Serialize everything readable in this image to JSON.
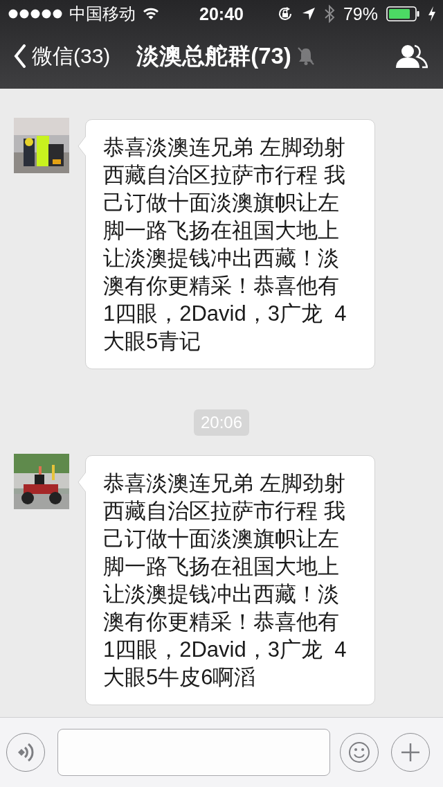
{
  "status_bar": {
    "carrier": "中国移动",
    "time": "20:40",
    "battery": "79%"
  },
  "nav": {
    "back": "微信(33)",
    "title": "淡澳总舵群(73)",
    "muted": true
  },
  "messages": [
    {
      "kind": "message",
      "text": "恭喜淡澳连兄弟 左脚劲射西藏自治区拉萨市行程 我己订做十面淡澳旗帜让左脚一路飞扬在祖国大地上让淡澳提钱冲出西藏！淡澳有你更精采！恭喜他有1四眼，2David，3广龙  4大眼5青记"
    },
    {
      "kind": "time",
      "text": "20:06"
    },
    {
      "kind": "message",
      "text": "恭喜淡澳连兄弟 左脚劲射西藏自治区拉萨市行程 我己订做十面淡澳旗帜让左脚一路飞扬在祖国大地上让淡澳提钱冲出西藏！淡澳有你更精采！恭喜他有1四眼，2David，3广龙  4大眼5牛皮6啊滔"
    }
  ]
}
